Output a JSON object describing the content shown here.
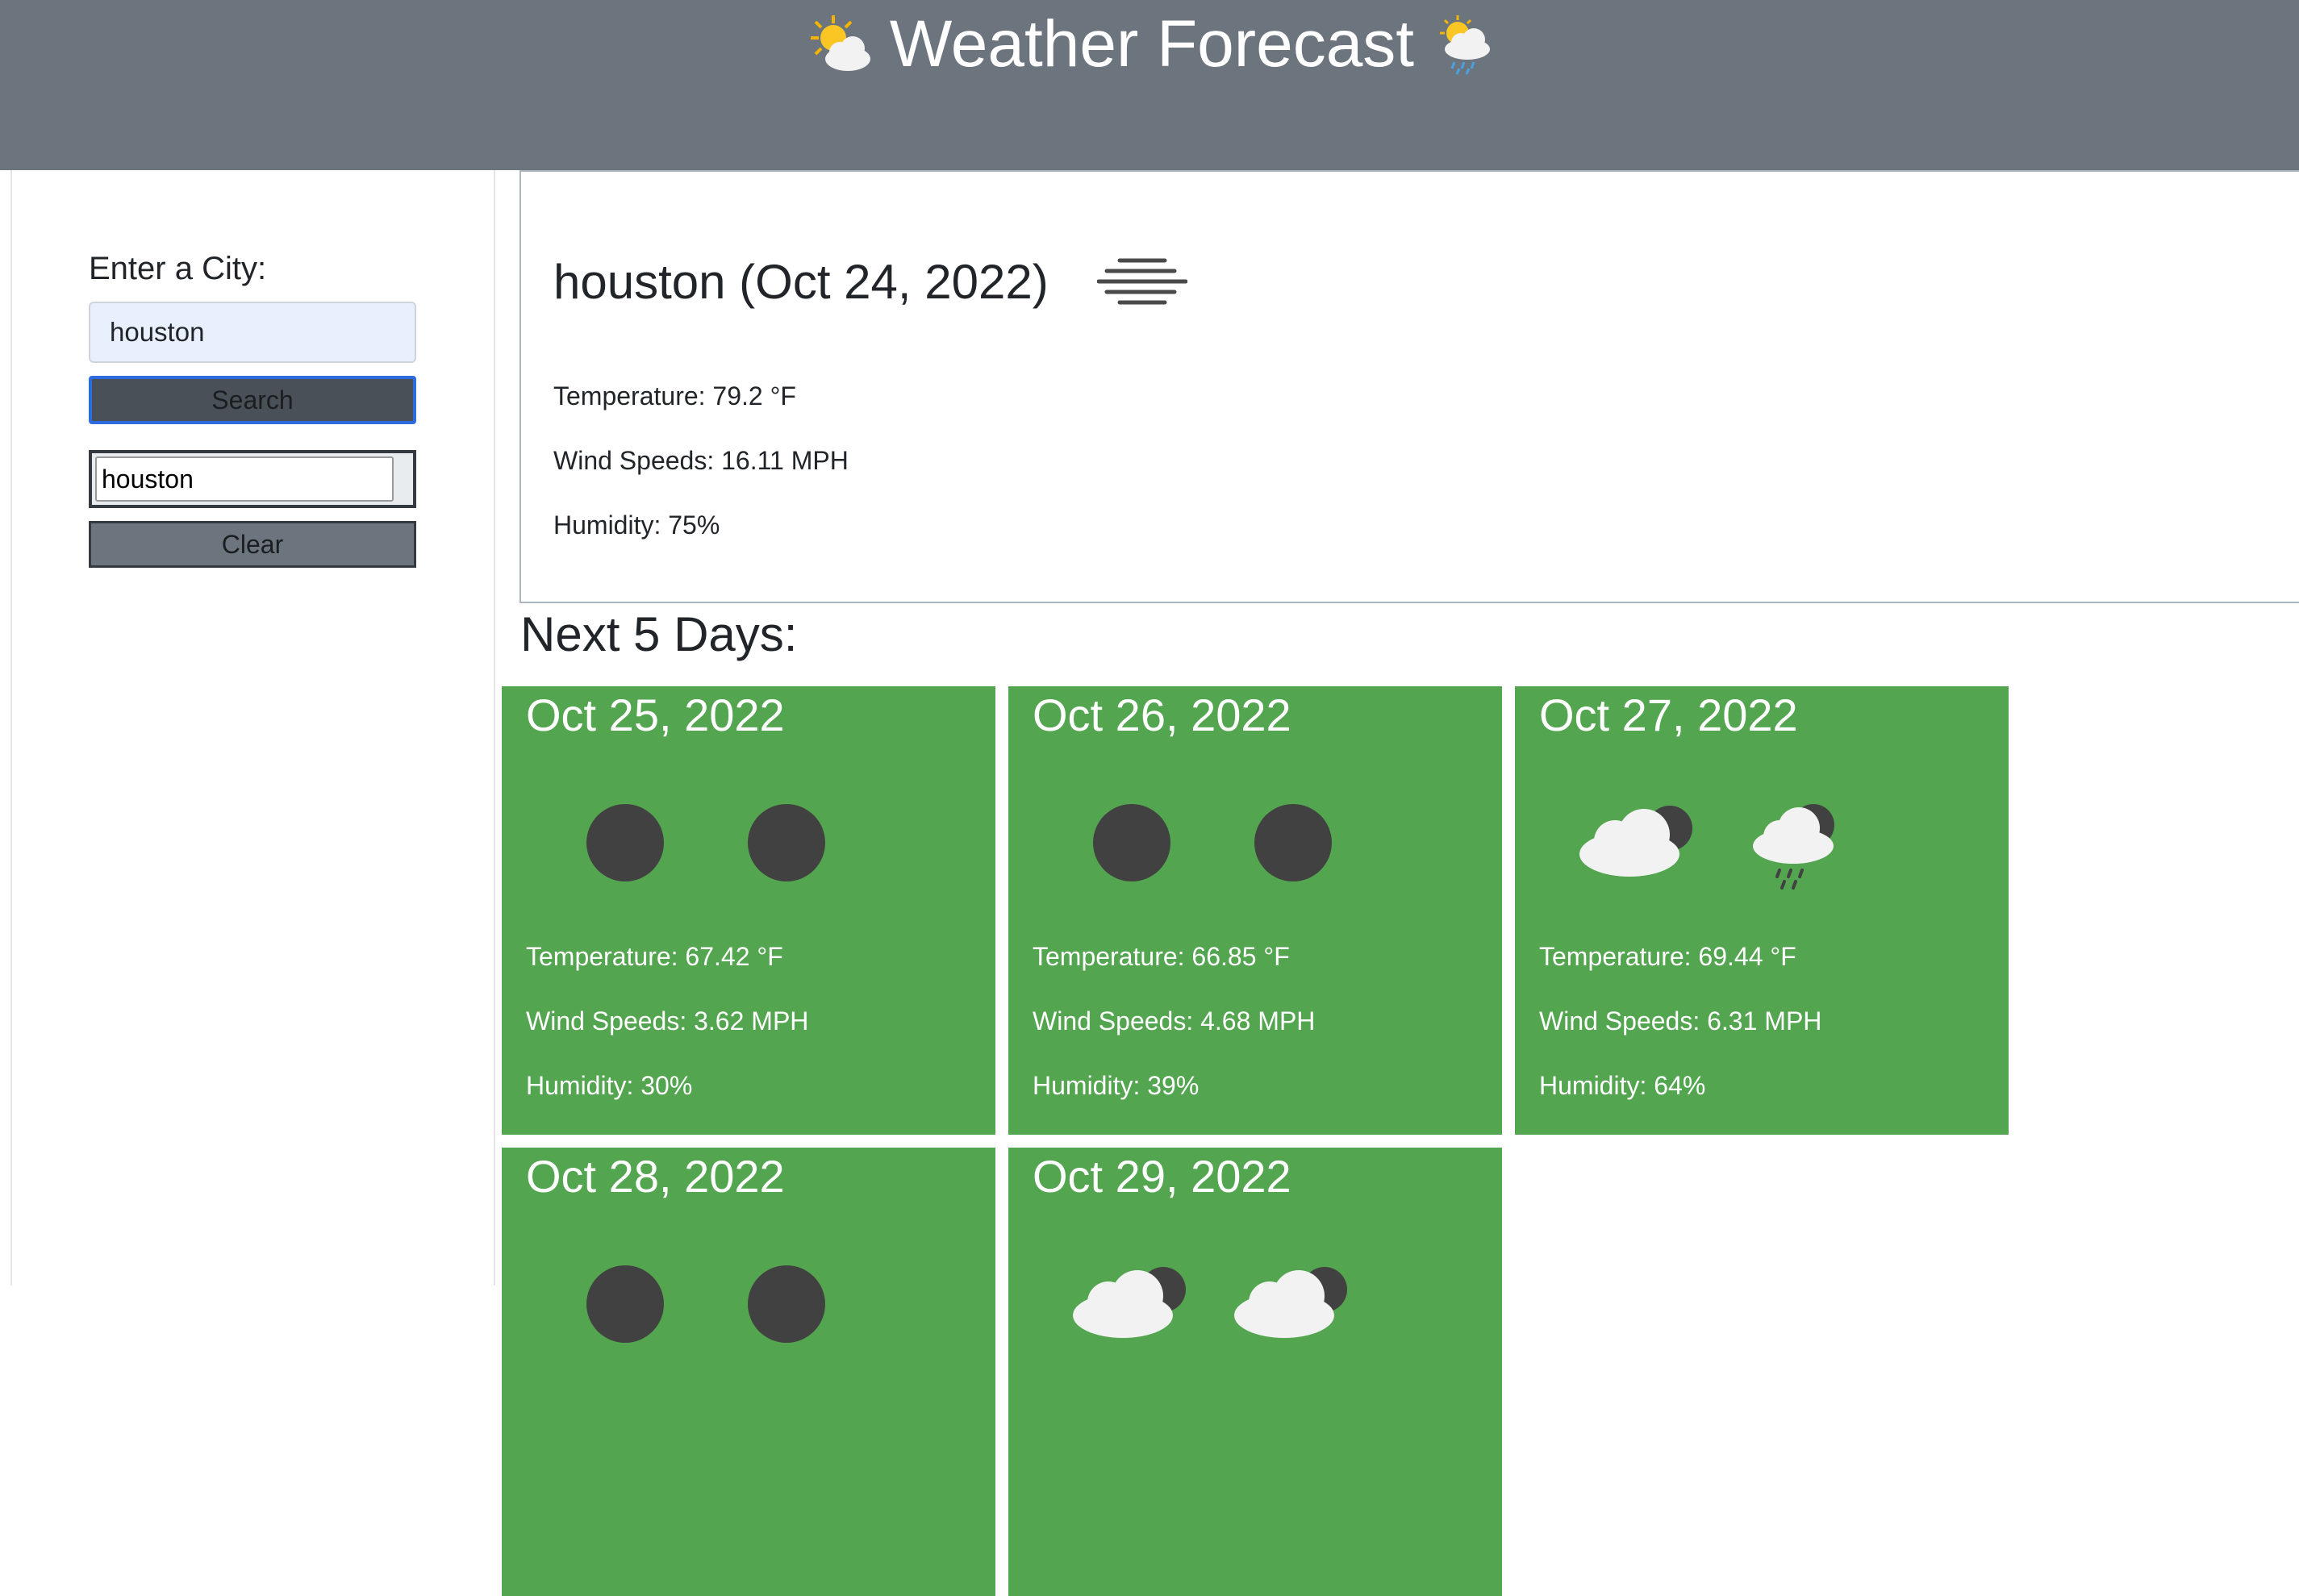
{
  "header": {
    "title": "Weather Forecast",
    "left_icon": "sun-behind-cloud-icon",
    "right_icon": "cloud-rain-sun-icon"
  },
  "sidebar": {
    "label": "Enter a City:",
    "input_value": "houston",
    "search_label": "Search",
    "history_value": "houston",
    "clear_label": "Clear"
  },
  "current": {
    "title": "houston (Oct 24, 2022)",
    "icon": "mist-icon",
    "temperature": "Temperature: 79.2 °F",
    "wind": "Wind Speeds: 16.11 MPH",
    "humidity": "Humidity: 75%"
  },
  "forecast": {
    "title": "Next 5 Days:",
    "days": [
      {
        "date": "Oct 25, 2022",
        "icons": [
          "dark-circle-icon",
          "dark-circle-icon"
        ],
        "temperature": "Temperature: 67.42 °F",
        "wind": "Wind Speeds: 3.62 MPH",
        "humidity": "Humidity: 30%"
      },
      {
        "date": "Oct 26, 2022",
        "icons": [
          "dark-circle-icon",
          "dark-circle-icon"
        ],
        "temperature": "Temperature: 66.85 °F",
        "wind": "Wind Speeds: 4.68 MPH",
        "humidity": "Humidity: 39%"
      },
      {
        "date": "Oct 27, 2022",
        "icons": [
          "cloud-night-icon",
          "rain-night-icon"
        ],
        "temperature": "Temperature: 69.44 °F",
        "wind": "Wind Speeds: 6.31 MPH",
        "humidity": "Humidity: 64%"
      },
      {
        "date": "Oct 28, 2022",
        "icons": [
          "dark-circle-icon",
          "dark-circle-icon"
        ]
      },
      {
        "date": "Oct 29, 2022",
        "icons": [
          "cloud-night-icon",
          "cloud-night-icon"
        ]
      }
    ]
  },
  "colors": {
    "header_bg": "#6c757d",
    "card_bg": "#53a550",
    "search_bg": "#495057",
    "search_border": "#2d6cdf",
    "input_bg": "#e8f0fe"
  }
}
